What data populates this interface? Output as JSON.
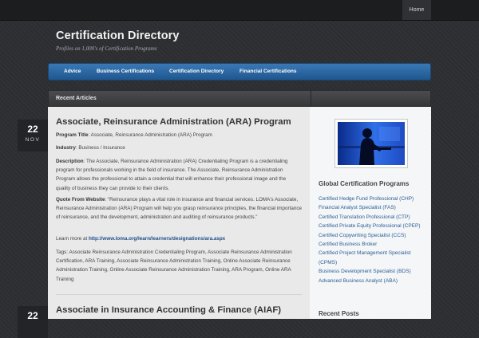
{
  "topbar": {
    "home_label": "Home"
  },
  "site": {
    "title": "Certification Directory",
    "tagline": "Profiles on 1,000's of Certification Programs"
  },
  "nav": {
    "items": [
      "Advice",
      "Business Certifications",
      "Certification Directory",
      "Financial Certifications"
    ]
  },
  "section": {
    "label": "Recent Articles"
  },
  "posts": [
    {
      "day": "22",
      "month": "NOV",
      "title": "Associate, Reinsurance Administration (ARA) Program",
      "program_title_label": "Program Title",
      "program_title_value": ": Associate, Reinsurance Administration (ARA) Program",
      "industry_label": "Industry",
      "industry_value": ": Business / Insurance",
      "description_label": "Description",
      "description_value": ":  The Associate, Reinsurance Administration (ARA) Credentialing Program is a credentialing program for professionals working in the field of insurance. The Associate, Reinsurance Administration Program allows the professional to attain a credential that will enhance their professional image and the quality of business they can provide to their clients.",
      "quote_label": "Quote From Website",
      "quote_value": ":  “Reinsurance plays a vital role in insurance and financial services. LOMA's Associate, Reinsurance Administration (ARA) Program will help you grasp reinsurance principles, the financial importance of reinsurance, and the development, administration and auditing of reinsurance products.”",
      "learn_more_prefix": "Learn more at ",
      "learn_more_url": "http://www.loma.org/learn/learners/designations/ara.aspx",
      "tags": "Tags:  Associate Reinsurance Administration Credentialing Program, Associate Reinsurance Administration Certification, ARA Training, Associate Reinsurance Administration Training, Online Associate Reinsurance Administration Training, Online Associate Reinsurance Administration Training, ARA Program, Online ARA Training"
    },
    {
      "day": "22",
      "title": "Associate in Insurance Accounting & Finance (AIAF)"
    }
  ],
  "sidebar": {
    "image_icon": "person-silhouette-icon",
    "certifications_title": "Global Certification Programs",
    "certifications": [
      "Certified Hedge Fund Professional (CHP)",
      "Financial Analyst Specialist (FAS)",
      "Certified Translation Professional (CTP)",
      "Certified Private Equity Professional (CPEP)",
      "Certified Copywriting Specialist (CCS)",
      "Certified Business Broker",
      "Certified Project Management Specialist (CPMS)",
      "Business Development Specialist (BDS)",
      "Advanced Business Analyst (ABA)"
    ],
    "recent_posts_title": "Recent Posts"
  },
  "colors": {
    "accent": "#2a65a6",
    "link": "#2b5d96",
    "background": "#2b2d30"
  }
}
